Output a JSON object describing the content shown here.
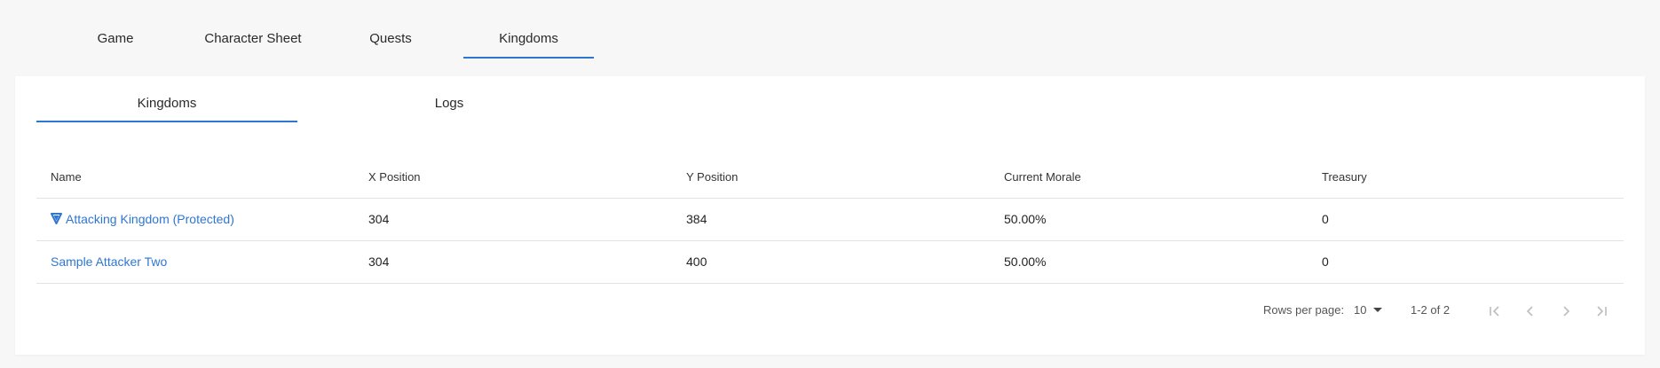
{
  "top_tabs": [
    {
      "label": "Game",
      "active": false
    },
    {
      "label": "Character Sheet",
      "active": false
    },
    {
      "label": "Quests",
      "active": false
    },
    {
      "label": "Kingdoms",
      "active": true
    }
  ],
  "inner_tabs": [
    {
      "label": "Kingdoms",
      "active": true
    },
    {
      "label": "Logs",
      "active": false
    }
  ],
  "table": {
    "headers": [
      "Name",
      "X Position",
      "Y Position",
      "Current Morale",
      "Treasury"
    ],
    "rows": [
      {
        "name": "Attacking Kingdom (Protected)",
        "protected": true,
        "x": "304",
        "y": "384",
        "morale": "50.00%",
        "treasury": "0"
      },
      {
        "name": "Sample Attacker Two",
        "protected": false,
        "x": "304",
        "y": "400",
        "morale": "50.00%",
        "treasury": "0"
      }
    ]
  },
  "pagination": {
    "rows_per_page_label": "Rows per page:",
    "rows_per_page_value": "10",
    "range_text": "1-2 of 2"
  },
  "colors": {
    "accent": "#2f76d2",
    "background": "#f7f7f7",
    "panel": "#ffffff"
  },
  "icons": {
    "protected": "shield-icon",
    "first_page": "first-page-icon",
    "prev_page": "chevron-left-icon",
    "next_page": "chevron-right-icon",
    "last_page": "last-page-icon"
  }
}
